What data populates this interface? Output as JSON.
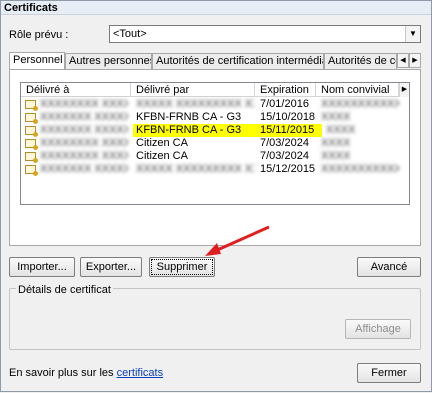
{
  "window": {
    "title": "Certificats"
  },
  "role": {
    "label": "Rôle prévu :",
    "selected": "<Tout>"
  },
  "tabs": [
    {
      "label": "Personnel",
      "active": true
    },
    {
      "label": "Autres personnes",
      "active": false
    },
    {
      "label": "Autorités de certification intermédiaires",
      "active": false
    },
    {
      "label": "Autorités de certifi",
      "active": false
    }
  ],
  "table": {
    "columns": [
      "Délivré à",
      "Délivré par",
      "Expiration",
      "Nom convivial"
    ],
    "rows": [
      {
        "issued_to": "",
        "issued_by": "",
        "expiration": "7/01/2016",
        "friendly": "",
        "highlight": false
      },
      {
        "issued_to": "",
        "issued_by": "KFBN-FRNB CA - G3",
        "expiration": "15/10/2018",
        "friendly": "",
        "highlight": false
      },
      {
        "issued_to": "",
        "issued_by": "KFBN-FRNB CA - G3",
        "expiration": "15/11/2015",
        "friendly": "",
        "highlight": true
      },
      {
        "issued_to": "",
        "issued_by": "Citizen CA",
        "expiration": "7/03/2024",
        "friendly": "",
        "highlight": false
      },
      {
        "issued_to": "",
        "issued_by": "Citizen CA",
        "expiration": "7/03/2024",
        "friendly": "",
        "highlight": false
      },
      {
        "issued_to": "",
        "issued_by": "",
        "expiration": "15/12/2015",
        "friendly": "",
        "highlight": false
      }
    ]
  },
  "buttons": {
    "import": "Importer...",
    "export": "Exporter...",
    "delete": "Supprimer",
    "advanced": "Avancé",
    "view": "Affichage",
    "close": "Fermer"
  },
  "details": {
    "label": "Détails de certificat"
  },
  "learn_more": {
    "prefix": "En savoir plus sur les ",
    "link": "certificats"
  },
  "colors": {
    "highlight": "#ffff00",
    "arrow": "#e02020",
    "link": "#0a3cbe"
  }
}
